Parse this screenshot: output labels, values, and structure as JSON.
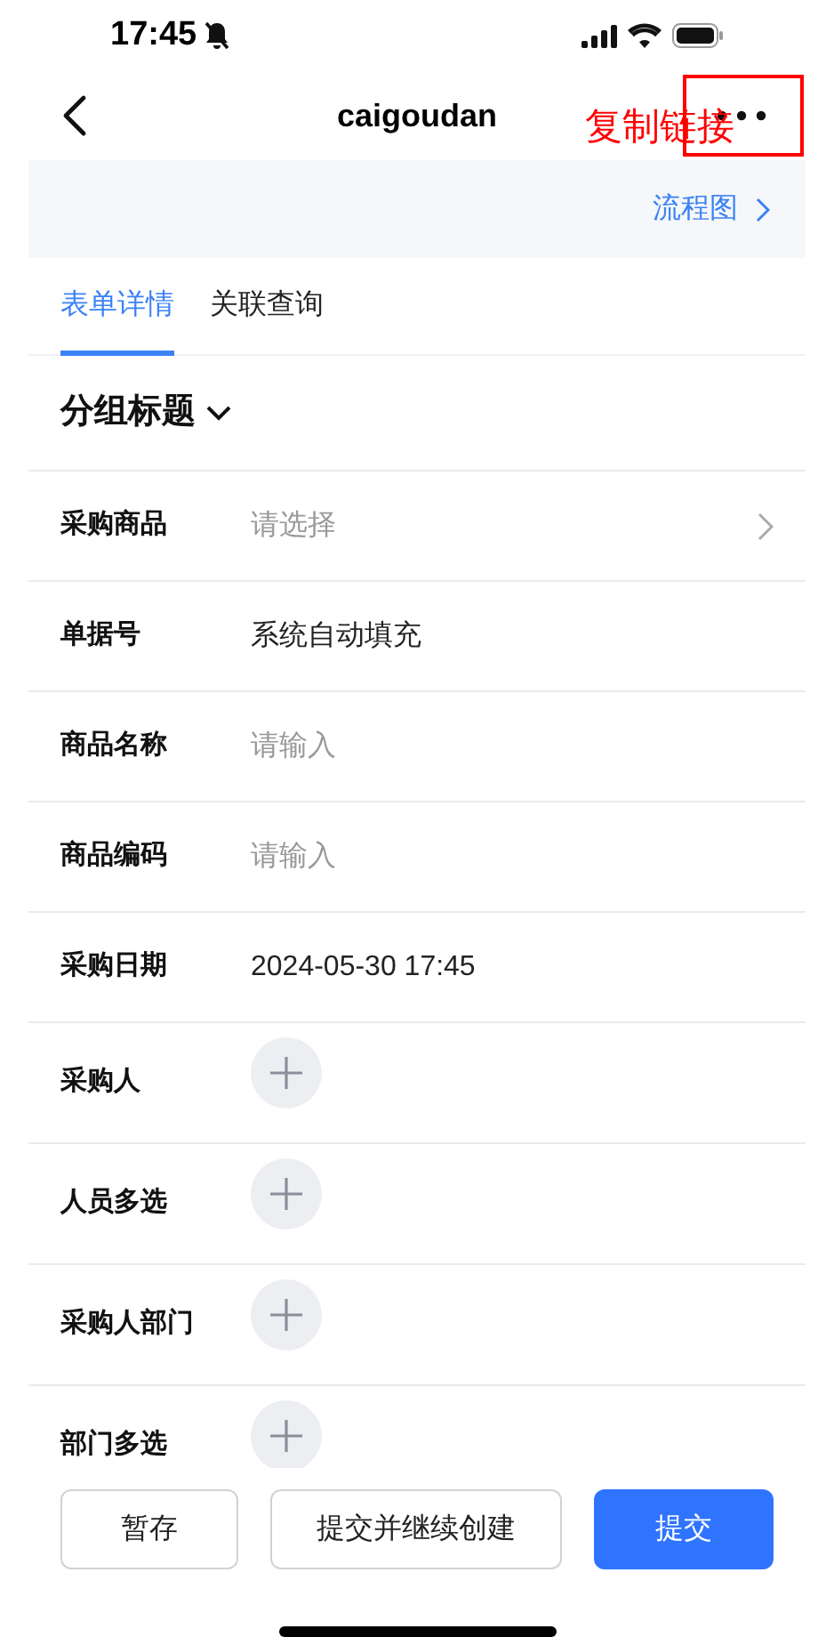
{
  "status_bar": {
    "time": "17:45",
    "muted": true
  },
  "nav": {
    "title": "caigoudan"
  },
  "annotation": {
    "text": "复制链接"
  },
  "flow_link": {
    "label": "流程图"
  },
  "tabs": [
    {
      "label": "表单详情",
      "selected": true
    },
    {
      "label": "关联查询",
      "selected": false
    }
  ],
  "section": {
    "title": "分组标题",
    "expanded": true
  },
  "fields": [
    {
      "kind": "select",
      "label": "采购商品",
      "placeholder": "请选择"
    },
    {
      "kind": "text",
      "label": "单据号",
      "value": "系统自动填充"
    },
    {
      "kind": "input",
      "label": "商品名称",
      "placeholder": "请输入"
    },
    {
      "kind": "input",
      "label": "商品编码",
      "placeholder": "请输入"
    },
    {
      "kind": "text",
      "label": "采购日期",
      "value": "2024-05-30 17:45"
    },
    {
      "kind": "picker",
      "label": "采购人"
    },
    {
      "kind": "picker",
      "label": "人员多选"
    },
    {
      "kind": "picker",
      "label": "采购人部门"
    },
    {
      "kind": "picker",
      "label": "部门多选"
    }
  ],
  "buttons": [
    {
      "label": "暂存",
      "primary": false
    },
    {
      "label": "提交并继续创建",
      "primary": false
    },
    {
      "label": "提交",
      "primary": true
    }
  ]
}
